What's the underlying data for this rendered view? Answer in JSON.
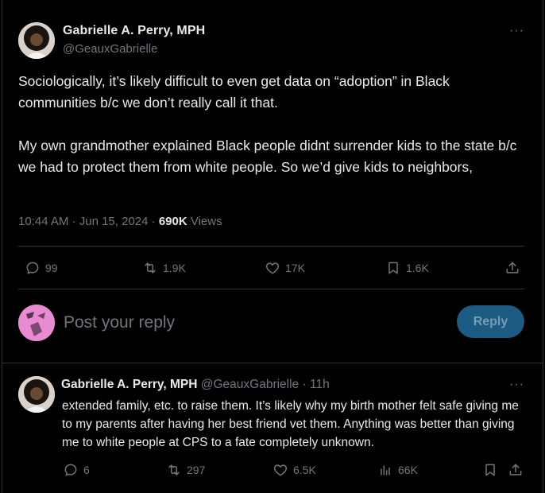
{
  "main_tweet": {
    "author_name": "Gabrielle A. Perry, MPH",
    "author_handle": "@GeauxGabrielle",
    "more": "···",
    "text": "Sociologically, it’s likely difficult to even get data on “adoption” in Black communities b/c we don’t really call it that.\n\nMy own grandmother explained Black people didnt surrender kids to the state b/c we had to protect them from white people. So we’d give kids to neighbors,",
    "time": "10:44 AM",
    "date": "Jun 15, 2024",
    "views_count": "690K",
    "views_label": "Views",
    "stats": {
      "replies": "99",
      "retweets": "1.9K",
      "likes": "17K",
      "bookmarks": "1.6K"
    }
  },
  "reply_box": {
    "placeholder": "Post your reply",
    "button_label": "Reply"
  },
  "reply_tweet": {
    "author_name": "Gabrielle A. Perry, MPH",
    "author_handle": "@GeauxGabrielle",
    "time_ago": "11h",
    "more": "···",
    "text": "extended family, etc. to raise them. It’s likely why my birth mother felt safe giving me to my parents after having her best friend vet them. Anything was better than giving me to white people at CPS to a fate completely unknown.",
    "stats": {
      "replies": "6",
      "retweets": "297",
      "likes": "6.5K",
      "views": "66K"
    }
  },
  "colors": {
    "background": "#000000",
    "text_primary": "#e7e9ea",
    "text_secondary": "#71767b",
    "border": "#2f3336",
    "reply_button": "#1c5b83",
    "reply_avatar": "#e98bd3"
  }
}
